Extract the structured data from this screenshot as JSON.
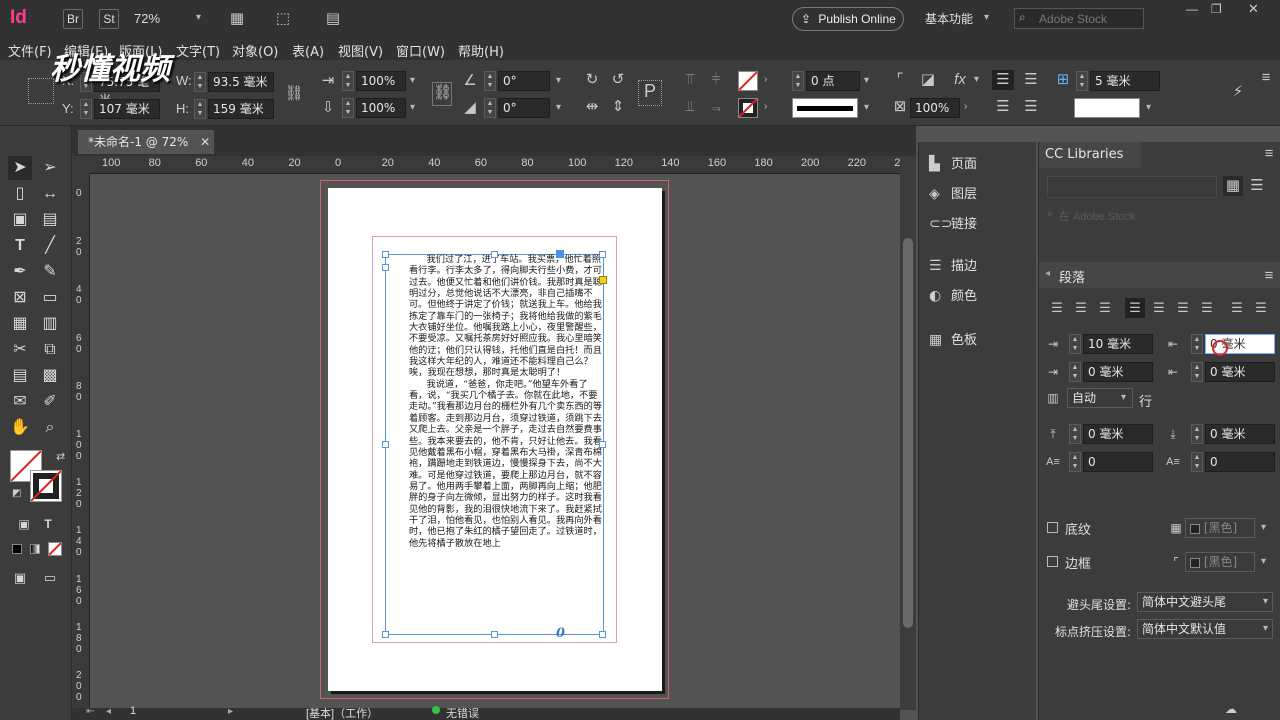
{
  "app": {
    "logo": "Id",
    "bridge_btn": "Br",
    "stock_btn": "St",
    "zoom": "72%",
    "publish_online": "Publish Online",
    "workspace": "基本功能",
    "search_placeholder": "Adobe Stock"
  },
  "menu": [
    "文件(F)",
    "编辑(E)",
    "版面(L)",
    "文字(T)",
    "对象(O)",
    "表(A)",
    "视图(V)",
    "窗口(W)",
    "帮助(H)"
  ],
  "watermark": "秒懂视频",
  "control": {
    "x_label": "X:",
    "x_value": "75.75 毫米",
    "y_label": "Y:",
    "y_value": "107 毫米",
    "w_label": "W:",
    "w_value": "93.5 毫米",
    "h_label": "H:",
    "h_value": "159 毫米",
    "scale_x": "100%",
    "scale_y": "100%",
    "rotate": "0°",
    "shear": "0°",
    "stroke_weight": "0 点",
    "opacity": "100%",
    "column_gap": "5 毫米"
  },
  "document": {
    "tab_title": "*未命名-1 @ 72%",
    "ruler_h": [
      "100",
      "80",
      "60",
      "40",
      "20",
      "0",
      "20",
      "40",
      "60",
      "80",
      "100",
      "120",
      "140",
      "160",
      "180",
      "200",
      "220",
      "240"
    ],
    "ruler_v": [
      "0",
      "2\n0",
      "4\n0",
      "6\n0",
      "8\n0",
      "1\n0\n0",
      "1\n2\n0",
      "1\n4\n0",
      "1\n6\n0",
      "1\n8\n0",
      "2\n0\n0"
    ],
    "body_text": "      我们过了江，进了车站。我买票，他忙着照看行李。行李太多了，得向脚夫行些小费，才可过去。他便又忙着和他们讲价钱。我那时真是聪明过分，总觉他说话不大漂亮，非自己插嘴不可。但他终于讲定了价钱；就送我上车。他给我拣定了靠车门的一张椅子；我将他给我做的紫毛大衣铺好坐位。他嘱我路上小心，夜里警醒些，不要受凉。又嘱托茶房好好照应我。我心里暗笑他的迂；他们只认得钱，托他们直是白托！而且我这样大年纪的人，难道还不能料理自己么？唉，我现在想想，那时真是太聪明了！\n      我说道，“爸爸，你走吧。”他望车外看了看，说，“我买几个橘子去。你就在此地，不要走动。”我看那边月台的栅栏外有几个卖东西的等着顾客。走到那边月台，须穿过铁道，须跳下去又爬上去。父亲是一个胖子，走过去自然要费事些。我本来要去的，他不肯，只好让他去。我看见他戴着黑布小帽，穿着黑布大马褂，深青布棉袍，蹒跚地走到铁道边，慢慢探身下去，尚不大难。可是他穿过铁道，要爬上那边月台，就不容易了。他用两手攀着上面，两脚再向上缩；他肥胖的身子向左微倾，显出努力的样子。这时我看见他的背影，我的泪很快地流下来了。我赶紧拭干了泪，怕他看见，也怕别人看见。我再向外看时，他已抱了朱红的橘子望回走了。过铁道时，他先将橘子散放在地上",
    "overset_glyph": "0"
  },
  "status": {
    "page": "1",
    "style": "[基本]（工作）",
    "preflight": "无错误"
  },
  "dock1": [
    "页面",
    "图层",
    "链接",
    "描边",
    "颜色",
    "色板"
  ],
  "libraries": {
    "title": "CC Libraries",
    "search_placeholder": "在 Adobe Stock"
  },
  "paragraph": {
    "title": "段落",
    "left_indent": "10 毫米",
    "right_indent": "0 毫米",
    "first_line_indent": "0 毫米",
    "last_line_indent": "0 毫米",
    "align_grid": "自动",
    "align_grid_label": "行",
    "space_before": "0 毫米",
    "space_after": "0 毫米",
    "drop_lines": "0",
    "drop_chars": "0",
    "shading_label": "底纹",
    "shading_swatch": "[黑色]",
    "border_label": "边框",
    "border_swatch": "[黑色]",
    "kinsoku_label": "避头尾设置:",
    "kinsoku_value": "简体中文避头尾",
    "mojikumi_label": "标点挤压设置:",
    "mojikumi_value": "简体中文默认值"
  },
  "colors": {
    "accent": "#ff3b8d",
    "frame": "#5b95d8",
    "bleed": "#c8686c"
  }
}
